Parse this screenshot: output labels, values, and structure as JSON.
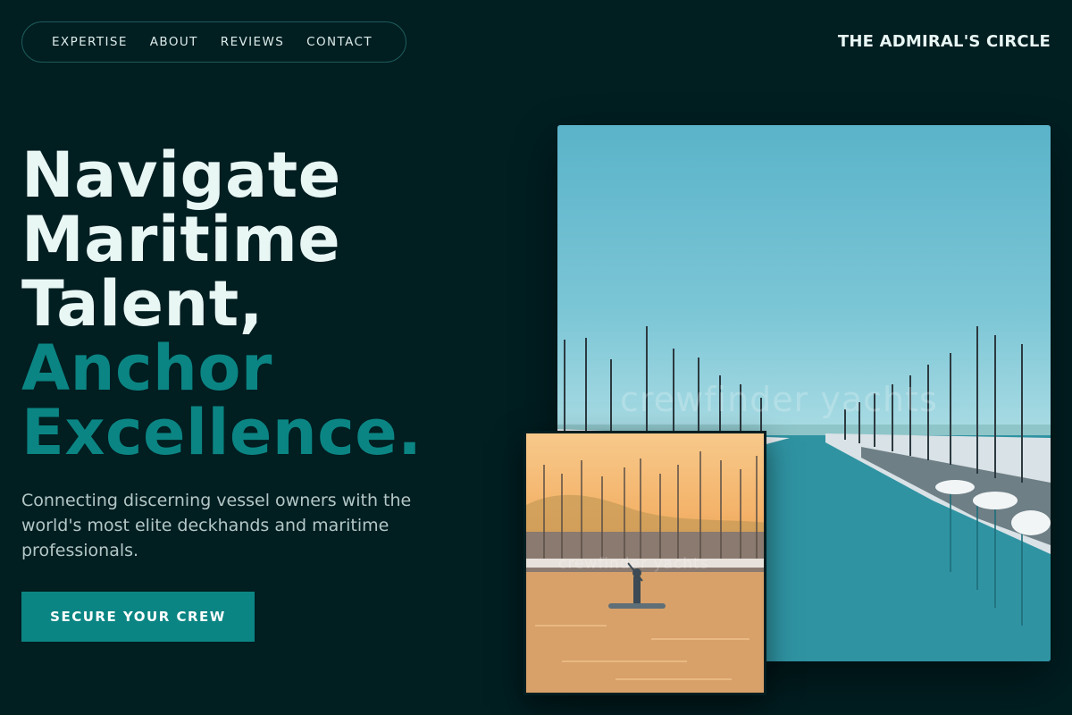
{
  "nav": {
    "links": [
      "EXPERTISE",
      "ABOUT",
      "REVIEWS",
      "CONTACT"
    ]
  },
  "brand": "THE ADMIRAL'S CIRCLE",
  "hero": {
    "headline_light": [
      "Navigate",
      "Maritime",
      "Talent,"
    ],
    "headline_accent": [
      "Anchor",
      "Excellence."
    ],
    "subtitle": "Connecting discerning vessel owners with the world's most elite deckhands and maritime professionals.",
    "cta_label": "SECURE YOUR CREW"
  },
  "images": {
    "main_watermark": "crewfinder yachts",
    "small_watermark": "crewfinder yachts"
  },
  "colors": {
    "background": "#011e21",
    "accent": "#0b8583",
    "text_light": "#e8f6f4",
    "text_muted": "#b3c7c6"
  }
}
